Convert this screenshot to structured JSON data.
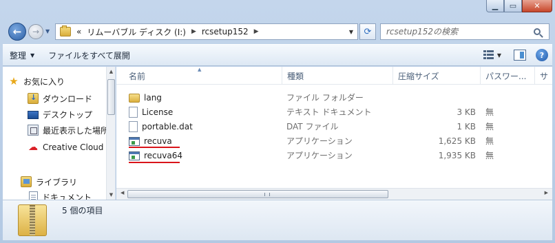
{
  "address": {
    "overflow": "«",
    "crumbs": [
      "リムーバブル ディスク (I:)",
      "rcsetup152"
    ]
  },
  "search": {
    "placeholder": "rcsetup152の検索"
  },
  "toolbar": {
    "organize": "整理",
    "burn": "ファイルをすべて展開"
  },
  "nav": {
    "favorites": "お気に入り",
    "downloads": "ダウンロード",
    "desktop": "デスクトップ",
    "recent": "最近表示した場所",
    "creative_cloud": "Creative Cloud",
    "libraries": "ライブラリ",
    "documents": "ドキュメント"
  },
  "columns": {
    "name": "名前",
    "type": "種類",
    "size": "圧縮サイズ",
    "password": "パスワー...",
    "more": "サ"
  },
  "files": [
    {
      "name": "lang",
      "icon": "folder-icon",
      "type": "ファイル フォルダー",
      "size": "",
      "password": ""
    },
    {
      "name": "License",
      "icon": "text-file-icon",
      "type": "テキスト ドキュメント",
      "size": "3 KB",
      "password": "無"
    },
    {
      "name": "portable.dat",
      "icon": "dat-file-icon",
      "type": "DAT ファイル",
      "size": "1 KB",
      "password": "無"
    },
    {
      "name": "recuva",
      "icon": "application-icon",
      "type": "アプリケーション",
      "size": "1,625 KB",
      "password": "無"
    },
    {
      "name": "recuva64",
      "icon": "application-icon",
      "type": "アプリケーション",
      "size": "1,935 KB",
      "password": "無"
    }
  ],
  "status": {
    "item_count": "5 個の項目"
  },
  "colors": {
    "annotation_underline": "#d9141a",
    "close_button": "#c7462a"
  }
}
